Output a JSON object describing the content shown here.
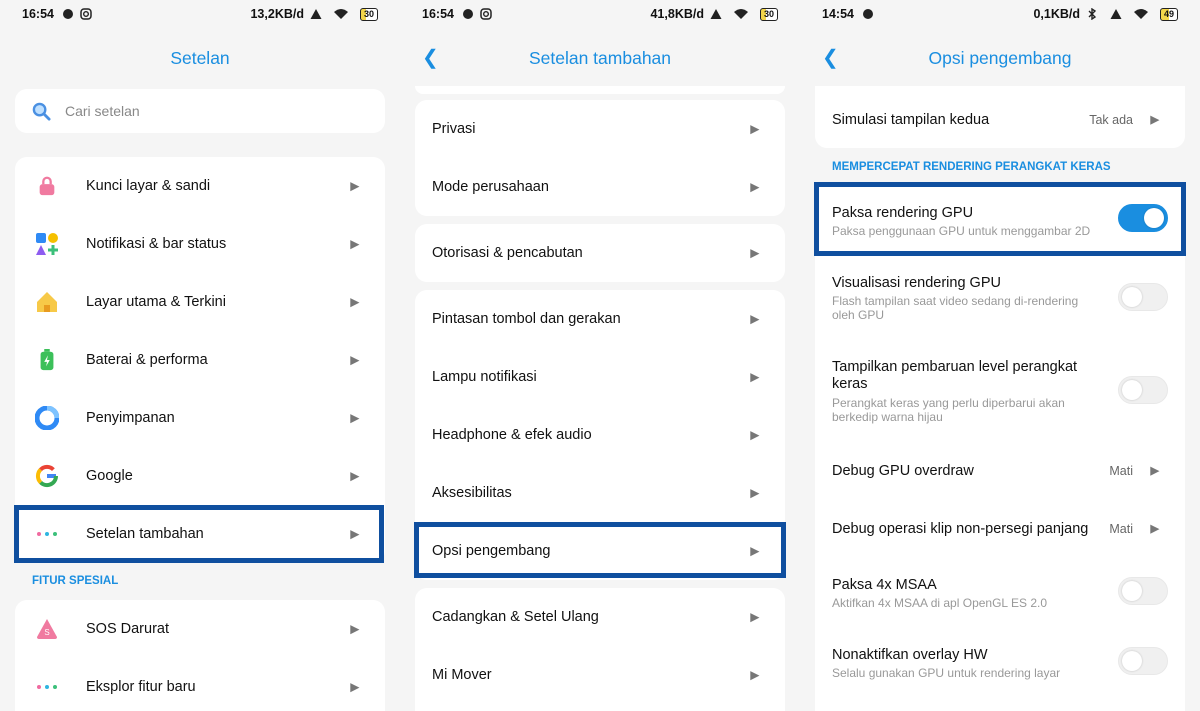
{
  "colors": {
    "accent": "#1a8ee0",
    "highlight": "#0f4f9f"
  },
  "panels": [
    {
      "status": {
        "time": "16:54",
        "speed": "13,2KB/d",
        "battery": "30"
      },
      "title": "Setelan",
      "search": {
        "placeholder": "Cari setelan"
      },
      "items": [
        {
          "label": "Kunci layar & sandi",
          "icon": "lock-icon"
        },
        {
          "label": "Notifikasi & bar status",
          "icon": "notification-icon"
        },
        {
          "label": "Layar utama & Terkini",
          "icon": "home-icon"
        },
        {
          "label": "Baterai & performa",
          "icon": "battery-icon"
        },
        {
          "label": "Penyimpanan",
          "icon": "storage-icon"
        },
        {
          "label": "Google",
          "icon": "google-icon"
        },
        {
          "label": "Setelan tambahan",
          "icon": "more-dots-icon"
        }
      ],
      "section": "FITUR SPESIAL",
      "special": [
        {
          "label": "SOS Darurat",
          "icon": "sos-icon"
        },
        {
          "label": "Eksplor fitur baru",
          "icon": "more-dots-icon"
        }
      ]
    },
    {
      "status": {
        "time": "16:54",
        "speed": "41,8KB/d",
        "battery": "30"
      },
      "title": "Setelan tambahan",
      "group1": [
        "Privasi",
        "Mode perusahaan"
      ],
      "group2": [
        "Otorisasi & pencabutan"
      ],
      "group3": [
        "Pintasan tombol dan gerakan",
        "Lampu notifikasi",
        "Headphone & efek audio",
        "Aksesibilitas",
        "Opsi pengembang"
      ],
      "group4": [
        "Cadangkan & Setel Ulang",
        "Mi Mover"
      ]
    },
    {
      "status": {
        "time": "14:54",
        "speed": "0,1KB/d",
        "battery": "49"
      },
      "title": "Opsi pengembang",
      "simulasi": {
        "title": "Simulasi tampilan kedua",
        "value": "Tak ada"
      },
      "section": "MEMPERCEPAT RENDERING PERANGKAT KERAS",
      "rows": [
        {
          "title": "Paksa rendering GPU",
          "subtitle": "Paksa penggunaan GPU untuk menggambar 2D",
          "on": true
        },
        {
          "title": "Visualisasi rendering GPU",
          "subtitle": "Flash tampilan saat video sedang di-rendering oleh GPU",
          "on": false
        },
        {
          "title": "Tampilkan pembaruan level perangkat keras",
          "subtitle": "Perangkat keras yang perlu diperbarui akan berkedip warna hijau",
          "on": false
        },
        {
          "title": "Debug GPU overdraw",
          "value": "Mati"
        },
        {
          "title": "Debug operasi klip non-persegi panjang",
          "value": "Mati"
        },
        {
          "title": "Paksa 4x MSAA",
          "subtitle": "Aktifkan 4x MSAA di apl OpenGL ES 2.0",
          "on": false
        },
        {
          "title": "Nonaktifkan overlay HW",
          "subtitle": "Selalu gunakan GPU untuk rendering layar",
          "on": false
        }
      ]
    }
  ]
}
